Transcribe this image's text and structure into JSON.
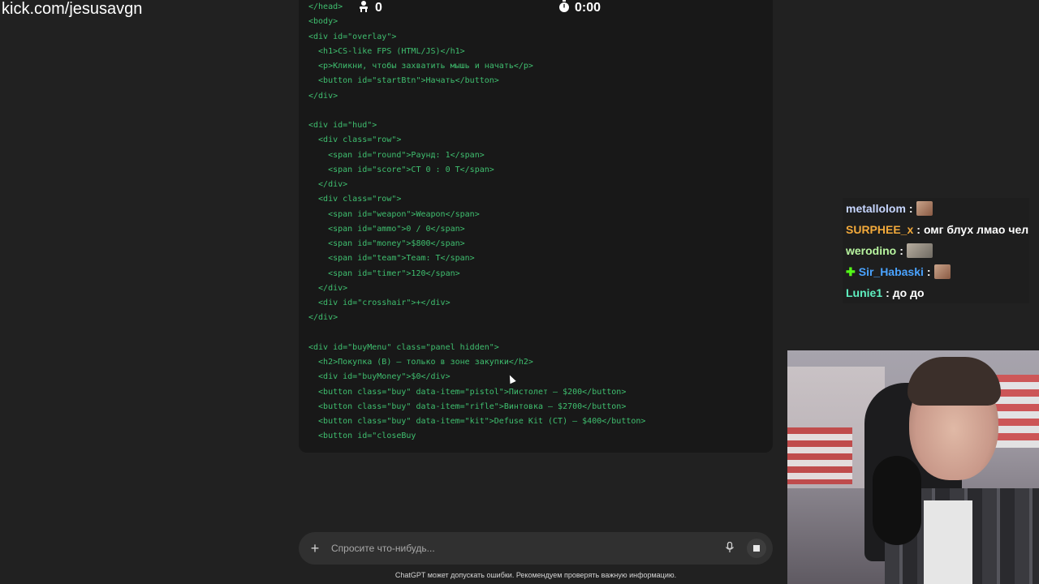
{
  "overlay": {
    "channel_url": "kick.com/jesusavgn"
  },
  "hud": {
    "players_count": "0",
    "timer": "0:00",
    "players_icon": "players-icon",
    "timer_icon": "stopwatch-icon"
  },
  "code": {
    "lines": [
      "</head>",
      "<body>",
      "<div id=\"overlay\">",
      "  <h1>CS-like FPS (HTML/JS)</h1>",
      "  <p>Кликни, чтобы захватить мышь и начать</p>",
      "  <button id=\"startBtn\">Начать</button>",
      "</div>",
      "",
      "<div id=\"hud\">",
      "  <div class=\"row\">",
      "    <span id=\"round\">Раунд: 1</span>",
      "    <span id=\"score\">CT 0 : 0 T</span>",
      "  </div>",
      "  <div class=\"row\">",
      "    <span id=\"weapon\">Weapon</span>",
      "    <span id=\"ammo\">0 / 0</span>",
      "    <span id=\"money\">$800</span>",
      "    <span id=\"team\">Team: T</span>",
      "    <span id=\"timer\">120</span>",
      "  </div>",
      "  <div id=\"crosshair\">+</div>",
      "</div>",
      "",
      "<div id=\"buyMenu\" class=\"panel hidden\">",
      "  <h2>Покупка (B) — только в зоне закупки</h2>",
      "  <div id=\"buyMoney\">$0</div>",
      "  <button class=\"buy\" data-item=\"pistol\">Пистолет — $200</button>",
      "  <button class=\"buy\" data-item=\"rifle\">Винтовка — $2700</button>",
      "  <button class=\"buy\" data-item=\"kit\">Defuse Kit (CT) — $400</button>",
      "  <button id=\"closeBuy"
    ]
  },
  "chat": {
    "messages": [
      {
        "user": "metallolom",
        "user_color": "#c7d6ff",
        "text": "",
        "emote": "emote-face"
      },
      {
        "user": "SURPHEE_x",
        "user_color": "#f2a93b",
        "text": "омг блух лмао чел",
        "emote": ""
      },
      {
        "user": "werodino",
        "user_color": "#b8f5a0",
        "text": "",
        "emote": "emote-wide"
      },
      {
        "user": "Sir_Habaski",
        "user_color": "#4aa3ff",
        "text": "",
        "emote": "emote-face",
        "badge": "plus-badge-icon"
      },
      {
        "user": "Lunie1",
        "user_color": "#5ff0c0",
        "text": "до до",
        "emote": ""
      }
    ]
  },
  "composer": {
    "placeholder": "Спросите что-нибудь...",
    "plus_icon": "plus-icon",
    "mic_icon": "microphone-icon",
    "stop_icon": "stop-icon"
  },
  "footer": {
    "disclaimer": "ChatGPT может допускать ошибки. Рекомендуем проверять важную информацию."
  },
  "colors": {
    "background": "#212121",
    "code_panel": "#181818",
    "code_text": "#3fbf6f",
    "composer": "#303030"
  }
}
